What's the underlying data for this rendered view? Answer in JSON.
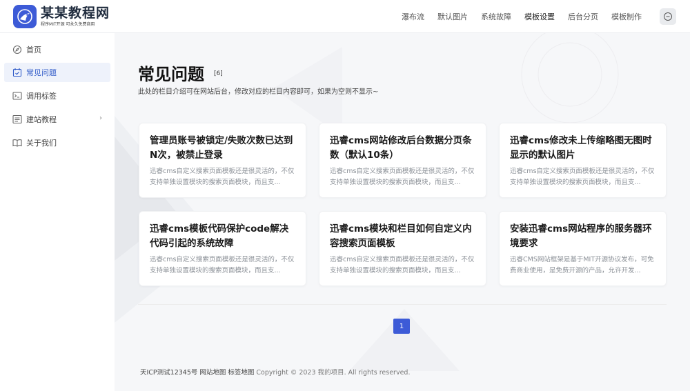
{
  "brand": {
    "title": "某某教程网",
    "subtitle": "程序MIT开源 可永久免费商用",
    "color": "#3d5bd7"
  },
  "nav": [
    {
      "label": "瀑布流"
    },
    {
      "label": "默认图片"
    },
    {
      "label": "系统故障"
    },
    {
      "label": "模板设置",
      "active": true
    },
    {
      "label": "后台分页"
    },
    {
      "label": "模板制作"
    }
  ],
  "sidebar": {
    "items": [
      {
        "label": "首页",
        "icon": "compass-icon"
      },
      {
        "label": "常见问题",
        "icon": "calendar-check-icon",
        "active": true
      },
      {
        "label": "调用标签",
        "icon": "terminal-icon"
      },
      {
        "label": "建站教程",
        "icon": "list-icon",
        "has_arrow": true
      },
      {
        "label": "关于我们",
        "icon": "book-icon"
      }
    ]
  },
  "page": {
    "title": "常见问题",
    "count": "[6]",
    "description": "此处的栏目介绍可在网站后台，修改对应的栏目内容即可，如果为空则不显示~"
  },
  "cards": [
    {
      "title": "管理员账号被锁定/失败次数已达到N次，被禁止登录",
      "desc": "迅睿cms自定义搜索页面模板还是很灵活的，不仅支持单独设置模块的搜索页面模块，而且支..."
    },
    {
      "title": "迅睿cms网站修改后台数据分页条数（默认10条）",
      "desc": "迅睿cms自定义搜索页面模板还是很灵活的，不仅支持单独设置模块的搜索页面模块，而且支..."
    },
    {
      "title": "迅睿cms修改未上传缩略图无图时显示的默认图片",
      "desc": "迅睿cms自定义搜索页面模板还是很灵活的，不仅支持单独设置模块的搜索页面模块，而且支..."
    },
    {
      "title": "迅睿cms模板代码保护code解决代码引起的系统故障",
      "desc": "迅睿cms自定义搜索页面模板还是很灵活的，不仅支持单独设置模块的搜索页面模块，而且支..."
    },
    {
      "title": "迅睿cms模块和栏目如何自定义内容搜索页面模板",
      "desc": "迅睿cms自定义搜索页面模板还是很灵活的，不仅支持单独设置模块的搜索页面模块，而且支..."
    },
    {
      "title": "安装迅睿cms网站程序的服务器环境要求",
      "desc": "迅睿CMS网站框架是基于MIT开源协议发布，可免费商业使用，是免费开源的产品，允许开发..."
    }
  ],
  "pagination": {
    "current": "1"
  },
  "footer": {
    "icp": "天ICP测试12345号",
    "sitemap": "网站地图",
    "tagmap": "标签地图",
    "copyright": "Copyright © 2023 我的项目. All rights reserved."
  }
}
